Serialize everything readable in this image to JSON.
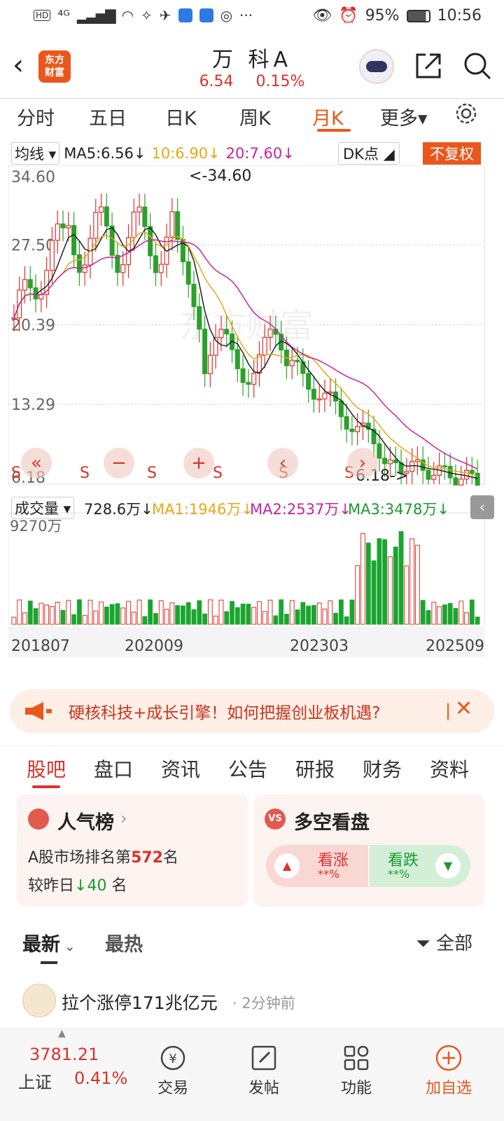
{
  "status_bar": {
    "left_icons": "HD ⁴ᴳ📶 ≈",
    "battery": "95%",
    "time": "10:56"
  },
  "header": {
    "back_icon": "chevron-left-icon",
    "app_logo": "东方\n财富",
    "stock_name": "万 科A",
    "price": "6.54",
    "change_pct": "0.15%",
    "colors": {
      "up": "#d9332c",
      "brand": "#e9571d",
      "down": "#199a2f"
    }
  },
  "period_tabs": [
    "分时",
    "五日",
    "日K",
    "周K",
    "月K",
    "更多▾"
  ],
  "active_period": "月K",
  "ma_row": {
    "selector": "均线",
    "ma5": "MA5:6.56↓",
    "ma10": "10:6.90↓",
    "ma20": "20:7.60↓",
    "dk": "DK点",
    "adjust": "不复权"
  },
  "price_axis": [
    "34.60",
    "27.50",
    "20.39",
    "13.29",
    "6.18"
  ],
  "chart_annotations": {
    "high": "<-34.60",
    "low": "6.18->"
  },
  "signal_label": "S",
  "volume_row": {
    "selector": "成交量",
    "vol": "728.6万↓",
    "ma1": "MA1:1946万↓",
    "ma2": "MA2:2537万↓",
    "ma3": "MA3:3478万↓",
    "axis_max": "9270万"
  },
  "date_axis": [
    "201807",
    "202009",
    "202303",
    "202509"
  ],
  "chart_data": {
    "type": "candlestick",
    "period": "monthly",
    "ylim": [
      6.18,
      34.6
    ],
    "x_ticks": [
      "201807",
      "202009",
      "202303",
      "202509"
    ],
    "volume_max": "9270万",
    "latest": {
      "close": 6.54,
      "change_pct": 0.15,
      "ma5": 6.56,
      "ma10": 6.9,
      "ma20": 7.6
    }
  },
  "banner": {
    "text": "硬核科技+成长引擎！如何把握创业板机遇?"
  },
  "sub_tabs": [
    "股吧",
    "盘口",
    "资讯",
    "公告",
    "研报",
    "财务",
    "资料"
  ],
  "active_sub_tab": "股吧",
  "popularity_card": {
    "title": "人气榜",
    "line1_prefix": "A股市场排名第",
    "rank": "572",
    "line1_suffix": "名",
    "line2_prefix": "较昨日",
    "delta": "40",
    "line2_suffix": " 名"
  },
  "vs_card": {
    "title": "多空看盘",
    "bull_label": "看涨",
    "bull_pct": "**%",
    "bear_label": "看跌",
    "bear_pct": "**%"
  },
  "filter_bar": {
    "latest": "最新",
    "hot": "最热",
    "all": "全部"
  },
  "post": {
    "title": "拉个涨停171兆亿元",
    "time": "· 2分钟前"
  },
  "bottom_nav": {
    "index_value": "3781.21",
    "index_name": "上证",
    "index_pct": "0.41%",
    "trade": "交易",
    "post": "发帖",
    "functions": "功能",
    "add_watch": "加自选"
  }
}
